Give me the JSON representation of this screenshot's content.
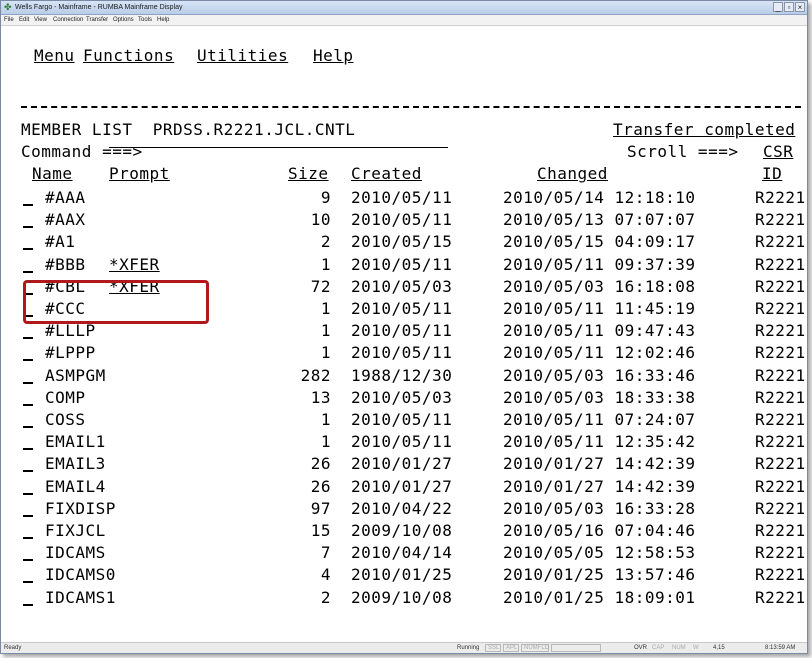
{
  "window": {
    "title": "Wells Fargo - Mainframe - RUMBA Mainframe Display",
    "minimize": "_",
    "maximize": "▫",
    "close": "×",
    "menu": [
      "File",
      "Edit",
      "View",
      "Connection",
      "Transfer",
      "Options",
      "Tools",
      "Help"
    ]
  },
  "terminal": {
    "menu": [
      "Menu",
      "Functions",
      "Utilities",
      "Help"
    ],
    "header_left": "MEMBER LIST  PRDSS.R2221.JCL.CNTL",
    "header_right": "Transfer completed",
    "command_label": "Command ===>",
    "scroll_label": "Scroll ===>",
    "scroll_value": "CSR",
    "columns": {
      "name": "Name",
      "prompt": "Prompt",
      "size": "Size",
      "created": "Created",
      "changed": "Changed",
      "id": "ID"
    },
    "rows": [
      {
        "name": "#AAA",
        "prompt": "",
        "size": "9",
        "created": "2010/05/11",
        "changed": "2010/05/14 12:18:10",
        "id": "R2221"
      },
      {
        "name": "#AAX",
        "prompt": "",
        "size": "10",
        "created": "2010/05/11",
        "changed": "2010/05/13 07:07:07",
        "id": "R2221"
      },
      {
        "name": "#A1",
        "prompt": "",
        "size": "2",
        "created": "2010/05/15",
        "changed": "2010/05/15 04:09:17",
        "id": "R2221"
      },
      {
        "name": "#BBB",
        "prompt": "*XFER",
        "size": "1",
        "created": "2010/05/11",
        "changed": "2010/05/11 09:37:39",
        "id": "R2221"
      },
      {
        "name": "#CBL",
        "prompt": "*XFER",
        "size": "72",
        "created": "2010/05/03",
        "changed": "2010/05/03 16:18:08",
        "id": "R2221"
      },
      {
        "name": "#CCC",
        "prompt": "",
        "size": "1",
        "created": "2010/05/11",
        "changed": "2010/05/11 11:45:19",
        "id": "R2221"
      },
      {
        "name": "#LLLP",
        "prompt": "",
        "size": "1",
        "created": "2010/05/11",
        "changed": "2010/05/11 09:47:43",
        "id": "R2221"
      },
      {
        "name": "#LPPP",
        "prompt": "",
        "size": "1",
        "created": "2010/05/11",
        "changed": "2010/05/11 12:02:46",
        "id": "R2221"
      },
      {
        "name": "ASMPGM",
        "prompt": "",
        "size": "282",
        "created": "1988/12/30",
        "changed": "2010/05/03 16:33:46",
        "id": "R2221"
      },
      {
        "name": "COMP",
        "prompt": "",
        "size": "13",
        "created": "2010/05/03",
        "changed": "2010/05/03 18:33:38",
        "id": "R2221"
      },
      {
        "name": "COSS",
        "prompt": "",
        "size": "1",
        "created": "2010/05/11",
        "changed": "2010/05/11 07:24:07",
        "id": "R2221"
      },
      {
        "name": "EMAIL1",
        "prompt": "",
        "size": "1",
        "created": "2010/05/11",
        "changed": "2010/05/11 12:35:42",
        "id": "R2221"
      },
      {
        "name": "EMAIL3",
        "prompt": "",
        "size": "26",
        "created": "2010/01/27",
        "changed": "2010/01/27 14:42:39",
        "id": "R2221"
      },
      {
        "name": "EMAIL4",
        "prompt": "",
        "size": "26",
        "created": "2010/01/27",
        "changed": "2010/01/27 14:42:39",
        "id": "R2221"
      },
      {
        "name": "FIXDISP",
        "prompt": "",
        "size": "97",
        "created": "2010/04/22",
        "changed": "2010/05/03 16:33:28",
        "id": "R2221"
      },
      {
        "name": "FIXJCL",
        "prompt": "",
        "size": "15",
        "created": "2009/10/08",
        "changed": "2010/05/16 07:04:46",
        "id": "R2221"
      },
      {
        "name": "IDCAMS",
        "prompt": "",
        "size": "7",
        "created": "2010/04/14",
        "changed": "2010/05/05 12:58:53",
        "id": "R2221"
      },
      {
        "name": "IDCAMS0",
        "prompt": "",
        "size": "4",
        "created": "2010/01/25",
        "changed": "2010/01/25 13:57:46",
        "id": "R2221"
      },
      {
        "name": "IDCAMS1",
        "prompt": "",
        "size": "2",
        "created": "2009/10/08",
        "changed": "2010/01/25 18:09:01",
        "id": "R2221"
      }
    ]
  },
  "statusbar": {
    "left": "Ready",
    "state": "Running",
    "indicators": [
      "SSL",
      "APL",
      "NUMFLD"
    ],
    "modes": [
      "OVR",
      "CAP",
      "NUM",
      "W"
    ],
    "cursor": "4,15",
    "time": "8:13:59 AM"
  },
  "colors": {
    "highlight_border": "#b0191c"
  }
}
